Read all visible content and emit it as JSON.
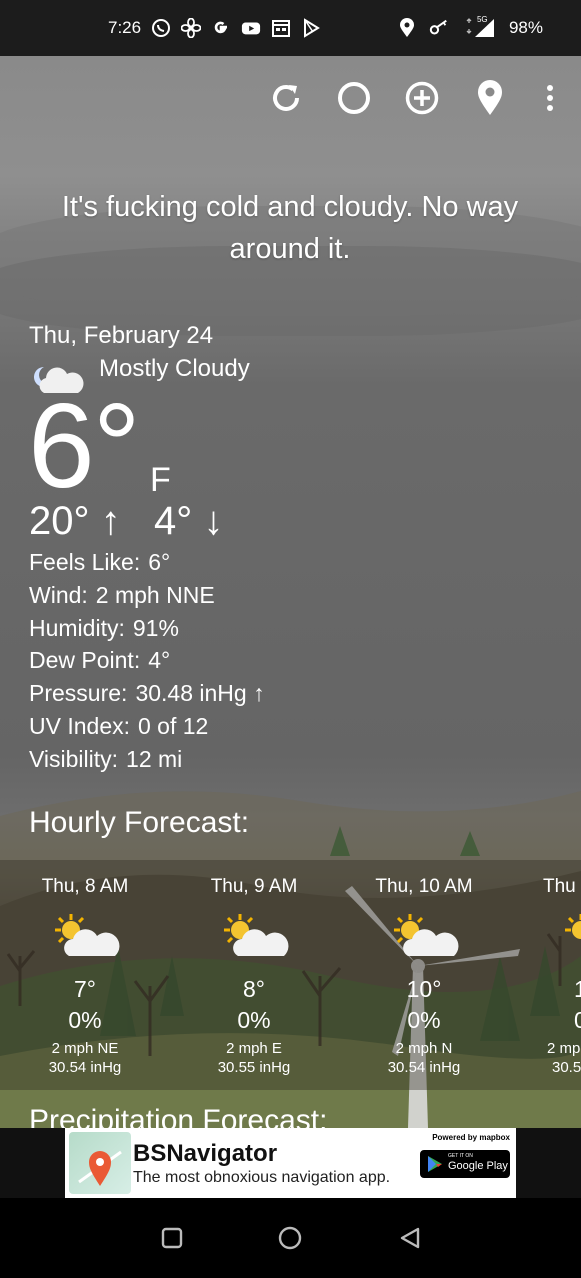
{
  "status_bar": {
    "time": "7:26",
    "left_icons": [
      "whatsapp-icon",
      "fan-icon",
      "google-icon",
      "youtube-icon",
      "calendar-icon",
      "play-store-icon"
    ],
    "right_icons": [
      "location-icon",
      "key-icon",
      "data-arrows-icon",
      "signal-5g-icon"
    ],
    "network_label": "5G",
    "battery": "98%"
  },
  "toolbar": {
    "actions": [
      "refresh",
      "theme",
      "add-location",
      "location",
      "more"
    ]
  },
  "headline": "It's fucking cold and cloudy. No way around it.",
  "current": {
    "date": "Thu, February 24",
    "condition": "Mostly Cloudy",
    "temp": "6°",
    "unit": "F",
    "high": "20°",
    "high_arrow": "↑",
    "low": "4°",
    "low_arrow": "↓"
  },
  "details": [
    {
      "label": "Feels Like:",
      "value": "6°"
    },
    {
      "label": "Wind:",
      "value": "2 mph NNE"
    },
    {
      "label": "Humidity:",
      "value": "91%"
    },
    {
      "label": "Dew Point:",
      "value": "4°"
    },
    {
      "label": "Pressure:",
      "value": "30.48 inHg ↑"
    },
    {
      "label": "UV Index:",
      "value": "0 of 12"
    },
    {
      "label": "Visibility:",
      "value": "12 mi"
    }
  ],
  "hourly": {
    "title": "Hourly Forecast:",
    "items": [
      {
        "time": "Thu, 8 AM",
        "temp": "7°",
        "pop": "0%",
        "wind": "2 mph NE",
        "pressure": "30.54 inHg"
      },
      {
        "time": "Thu, 9 AM",
        "temp": "8°",
        "pop": "0%",
        "wind": "2 mph E",
        "pressure": "30.55 inHg"
      },
      {
        "time": "Thu, 10 AM",
        "temp": "10°",
        "pop": "0%",
        "wind": "2 mph N",
        "pressure": "30.54 inHg"
      },
      {
        "time": "Thu",
        "temp": "1",
        "pop": "0",
        "wind": "2 mp",
        "pressure": "30.5"
      }
    ]
  },
  "precip_title": "Precipitation Forecast:",
  "ad": {
    "title": "BSNavigator",
    "subtitle": "The most obnoxious navigation app.",
    "powered": "Powered by mapbox",
    "store_small": "GET IT ON",
    "store_big": "Google Play"
  },
  "colors": {
    "sky": "#8a8a8a",
    "ground": "#3d392e",
    "sun": "#f4b400",
    "ad_bg": "#ffffff"
  }
}
